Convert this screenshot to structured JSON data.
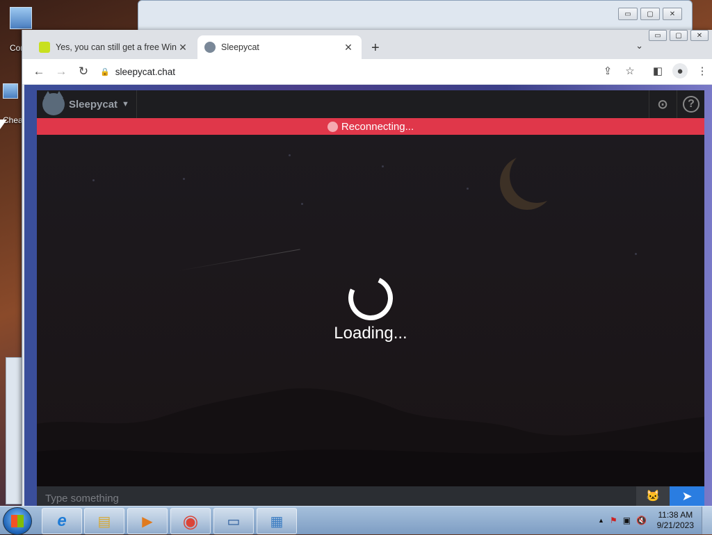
{
  "desktop": {
    "icons": [
      {
        "label": "Cor"
      },
      {
        "label": "Chea"
      }
    ]
  },
  "background_window": {
    "controls": [
      "▭",
      "▢",
      "✕"
    ]
  },
  "browser": {
    "window_controls": [
      "▭",
      "▢",
      "✕"
    ],
    "tabs": [
      {
        "title": "Yes, you can still get a free Windo",
        "close": "✕",
        "active": false
      },
      {
        "title": "Sleepycat",
        "close": "✕",
        "active": true
      }
    ],
    "new_tab": "+",
    "tab_dropdown": "⌄",
    "nav": {
      "back": "←",
      "forward": "→",
      "reload": "↻"
    },
    "address": {
      "lock": "🔒",
      "url": "sleepycat.chat"
    },
    "toolbar_icons": {
      "share": "⇪",
      "bookmark": "☆",
      "sidepanel": "◧",
      "profile": "●",
      "menu": "⋮"
    }
  },
  "app": {
    "brand": "Sleepycat",
    "caret": "▼",
    "user_icon": "⊙",
    "help_icon": "?",
    "banner": {
      "text": "Reconnecting..."
    },
    "loading_text": "Loading...",
    "composer": {
      "placeholder": "Type something",
      "cat_icon": "🐱",
      "send_icon": "➤"
    }
  },
  "taskbar": {
    "apps": [
      {
        "icon": "e",
        "color": "#1e7bd6"
      },
      {
        "icon": "▤",
        "color": "#d8a930"
      },
      {
        "icon": "▶",
        "color": "#e07a1f"
      },
      {
        "icon": "◉",
        "color": "#db4437"
      },
      {
        "icon": "▭",
        "color": "#2b5c9c"
      },
      {
        "icon": "▦",
        "color": "#3a7cc2"
      }
    ],
    "tray_icons": [
      "▲",
      "⚑",
      "▣",
      "🔇"
    ],
    "time": "11:38 AM",
    "date": "9/21/2023"
  }
}
